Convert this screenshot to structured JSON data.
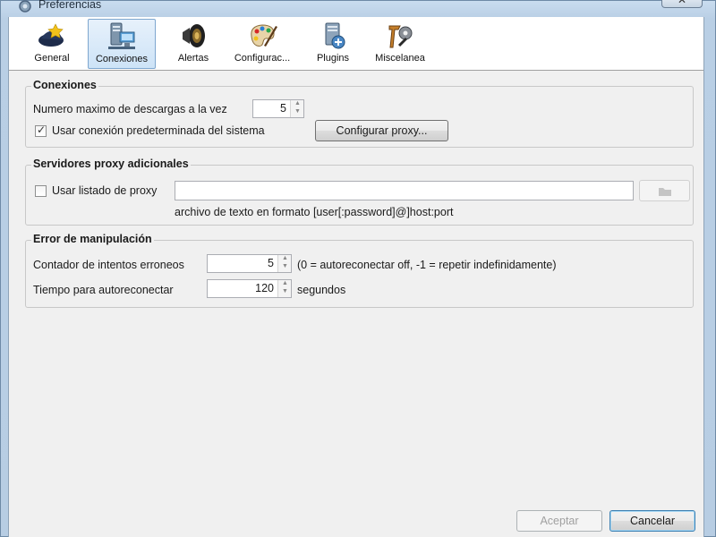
{
  "window": {
    "title": "Preferencias",
    "close_label": "✕"
  },
  "toolbar": {
    "items": [
      {
        "label": "General",
        "icon": "general-icon"
      },
      {
        "label": "Conexiones",
        "icon": "connections-icon",
        "active": true
      },
      {
        "label": "Alertas",
        "icon": "speaker-icon"
      },
      {
        "label": "Configurac...",
        "icon": "palette-icon"
      },
      {
        "label": "Plugins",
        "icon": "plugins-icon"
      },
      {
        "label": "Miscelanea",
        "icon": "tools-icon"
      }
    ]
  },
  "connections": {
    "title": "Conexiones",
    "max_downloads_label": "Numero maximo de descargas a la vez",
    "max_downloads_value": "5",
    "use_system_label": "Usar conexión predeterminada del sistema",
    "use_system_checked": true,
    "proxy_button": "Configurar proxy..."
  },
  "proxy_servers": {
    "title": "Servidores proxy adicionales",
    "use_list_label": "Usar listado de proxy",
    "use_list_checked": false,
    "path_value": "",
    "hint": "archivo de texto en formato [user[:password]@]host:port"
  },
  "error_handling": {
    "title": "Error de manipulación",
    "retry_label": "Contador de intentos erroneos",
    "retry_value": "5",
    "retry_hint": "(0 = autoreconectar off, -1 = repetir indefinidamente)",
    "reconnect_label": "Tiempo para autoreconectar",
    "reconnect_value": "120",
    "reconnect_unit": "segundos"
  },
  "buttons": {
    "accept": "Aceptar",
    "cancel": "Cancelar"
  }
}
